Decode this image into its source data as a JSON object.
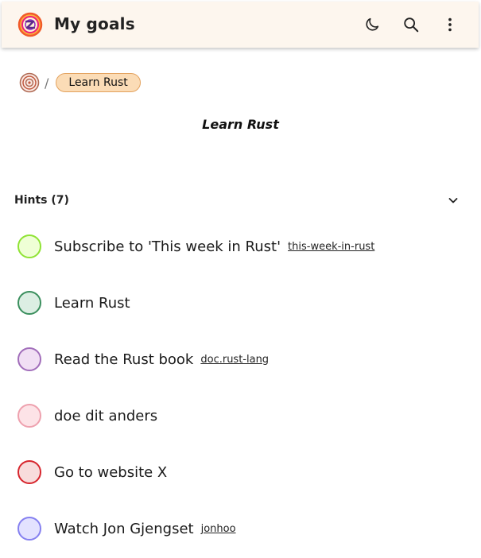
{
  "header": {
    "title": "My goals",
    "logo_icon": "zinzen-logo-icon",
    "buttons": {
      "dark_mode_icon": "moon-icon",
      "search_icon": "search-icon",
      "menu_icon": "more-vertical-icon"
    }
  },
  "breadcrumb": {
    "home_icon": "target-icon",
    "separator": "/",
    "current": "Learn Rust"
  },
  "goal": {
    "title": "Learn Rust"
  },
  "hints": {
    "label": "Hints (7)",
    "items": [
      {
        "text": "Subscribe to 'This week in Rust'",
        "link": "this-week-in-rust",
        "color_fill": "#efffd6",
        "color_border": "#8fe334"
      },
      {
        "text": "Learn Rust",
        "link": "",
        "color_fill": "#dceee3",
        "color_border": "#3b8f5e"
      },
      {
        "text": "Read the Rust book",
        "link": "doc.rust-lang",
        "color_fill": "#f1dff4",
        "color_border": "#a16dba"
      },
      {
        "text": "doe dit anders",
        "link": "",
        "color_fill": "#fde3e7",
        "color_border": "#eea1ae"
      },
      {
        "text": "Go to website X",
        "link": "",
        "color_fill": "#f8dcdc",
        "color_border": "#d7262e"
      },
      {
        "text": "Watch Jon Gjengset",
        "link": "jonhoo",
        "color_fill": "#e3e2ff",
        "color_border": "#8580f0"
      }
    ]
  }
}
